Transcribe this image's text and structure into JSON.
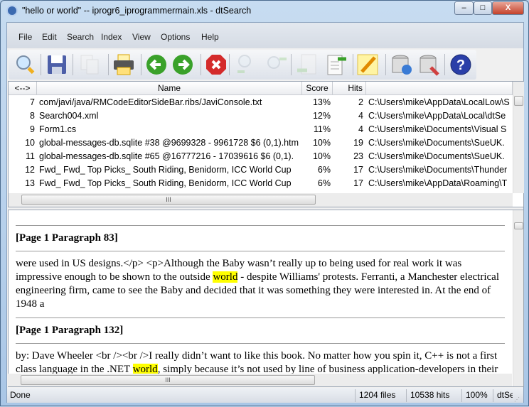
{
  "window": {
    "title": "\"hello or world\" -- iprogr6_iprogrammermain.xls - dtSearch",
    "minimize_label": "–",
    "maximize_label": "□",
    "close_label": "X"
  },
  "menu": [
    "File",
    "Edit",
    "Search",
    "Index",
    "View",
    "Options",
    "Help"
  ],
  "toolbar": [
    {
      "icon": "search-icon",
      "enabled": true
    },
    {
      "icon": "save-icon",
      "enabled": true
    },
    {
      "icon": "copy-icon",
      "enabled": false
    },
    {
      "icon": "print-icon",
      "enabled": true
    },
    {
      "icon": "back-icon",
      "enabled": true
    },
    {
      "icon": "forward-icon",
      "enabled": true
    },
    {
      "icon": "stop-icon",
      "enabled": true
    },
    {
      "icon": "previous-hit-icon",
      "enabled": false
    },
    {
      "icon": "next-hit-icon",
      "enabled": false
    },
    {
      "icon": "previous-document-icon",
      "enabled": false
    },
    {
      "icon": "next-document-icon",
      "enabled": true
    },
    {
      "icon": "edit-icon",
      "enabled": true
    },
    {
      "icon": "update-index-icon",
      "enabled": true
    },
    {
      "icon": "index-manager-icon",
      "enabled": true
    },
    {
      "icon": "help-icon",
      "enabled": true
    }
  ],
  "results": {
    "columns": [
      "<-->",
      "Name",
      "Score",
      "Hits",
      ""
    ],
    "rows": [
      {
        "n": "7",
        "name": "com/javi/java/RMCodeEditorSideBar.ribs/JaviConsole.txt",
        "score": "13%",
        "hits": "2",
        "path": "C:\\Users\\mike\\AppData\\LocalLow\\S"
      },
      {
        "n": "8",
        "name": "Search004.xml",
        "score": "12%",
        "hits": "4",
        "path": "C:\\Users\\mike\\AppData\\Local\\dtSe"
      },
      {
        "n": "9",
        "name": "Form1.cs",
        "score": "11%",
        "hits": "4",
        "path": "C:\\Users\\mike\\Documents\\Visual S"
      },
      {
        "n": "10",
        "name": "global-messages-db.sqlite #38 @9699328 - 9961728 $6 (0,1).htm",
        "score": "10%",
        "hits": "19",
        "path": "C:\\Users\\mike\\Documents\\SueUK."
      },
      {
        "n": "11",
        "name": "global-messages-db.sqlite #65 @16777216 - 17039616 $6 (0,1).",
        "score": "10%",
        "hits": "23",
        "path": "C:\\Users\\mike\\Documents\\SueUK."
      },
      {
        "n": "12",
        "name": "Fwd_ Fwd_ Top Picks_ South Riding, Benidorm, ICC World Cup",
        "score": "6%",
        "hits": "17",
        "path": "C:\\Users\\mike\\Documents\\Thunder"
      },
      {
        "n": "13",
        "name": "Fwd_ Fwd_ Top Picks_ South Riding, Benidorm, ICC World Cup",
        "score": "6%",
        "hits": "17",
        "path": "C:\\Users\\mike\\AppData\\Roaming\\T"
      }
    ],
    "scroll_thumb_label": "III"
  },
  "preview": {
    "blocks": [
      {
        "heading": "[Page 1 Paragraph 83]",
        "lines": [
          {
            "a": "were used in US designs.</p> <p>Although the Baby wasn’t really up to being used for real work it was",
            "h": "",
            "b": ""
          },
          {
            "a": "impressive enough to be shown to the outside ",
            "h": "world",
            "b": " - despite Williams' protests. Ferranti, a Manchester electrical"
          },
          {
            "a": "engineering firm, came to see the Baby and decided that it was something they were interested in. At the end of",
            "h": "",
            "b": ""
          },
          {
            "a": "1948 a",
            "h": "",
            "b": ""
          }
        ]
      },
      {
        "heading": "[Page 1 Paragraph 132]",
        "lines": [
          {
            "a": "by: Dave Wheeler <br /><br />I really didn’t want to like this book. No matter how you spin it, C++ is not a first",
            "h": "",
            "b": ""
          },
          {
            "a": "class language in the .NET ",
            "h": "world",
            "b": ", simply because it’s not used by line of business application-developers in their"
          }
        ]
      }
    ],
    "highlight_color": "#ffff00",
    "scroll_thumb_label": "III"
  },
  "status": {
    "message": "Done",
    "files": "1204 files",
    "hits": "10538 hits",
    "zoom": "100%",
    "app": "dtSe"
  }
}
